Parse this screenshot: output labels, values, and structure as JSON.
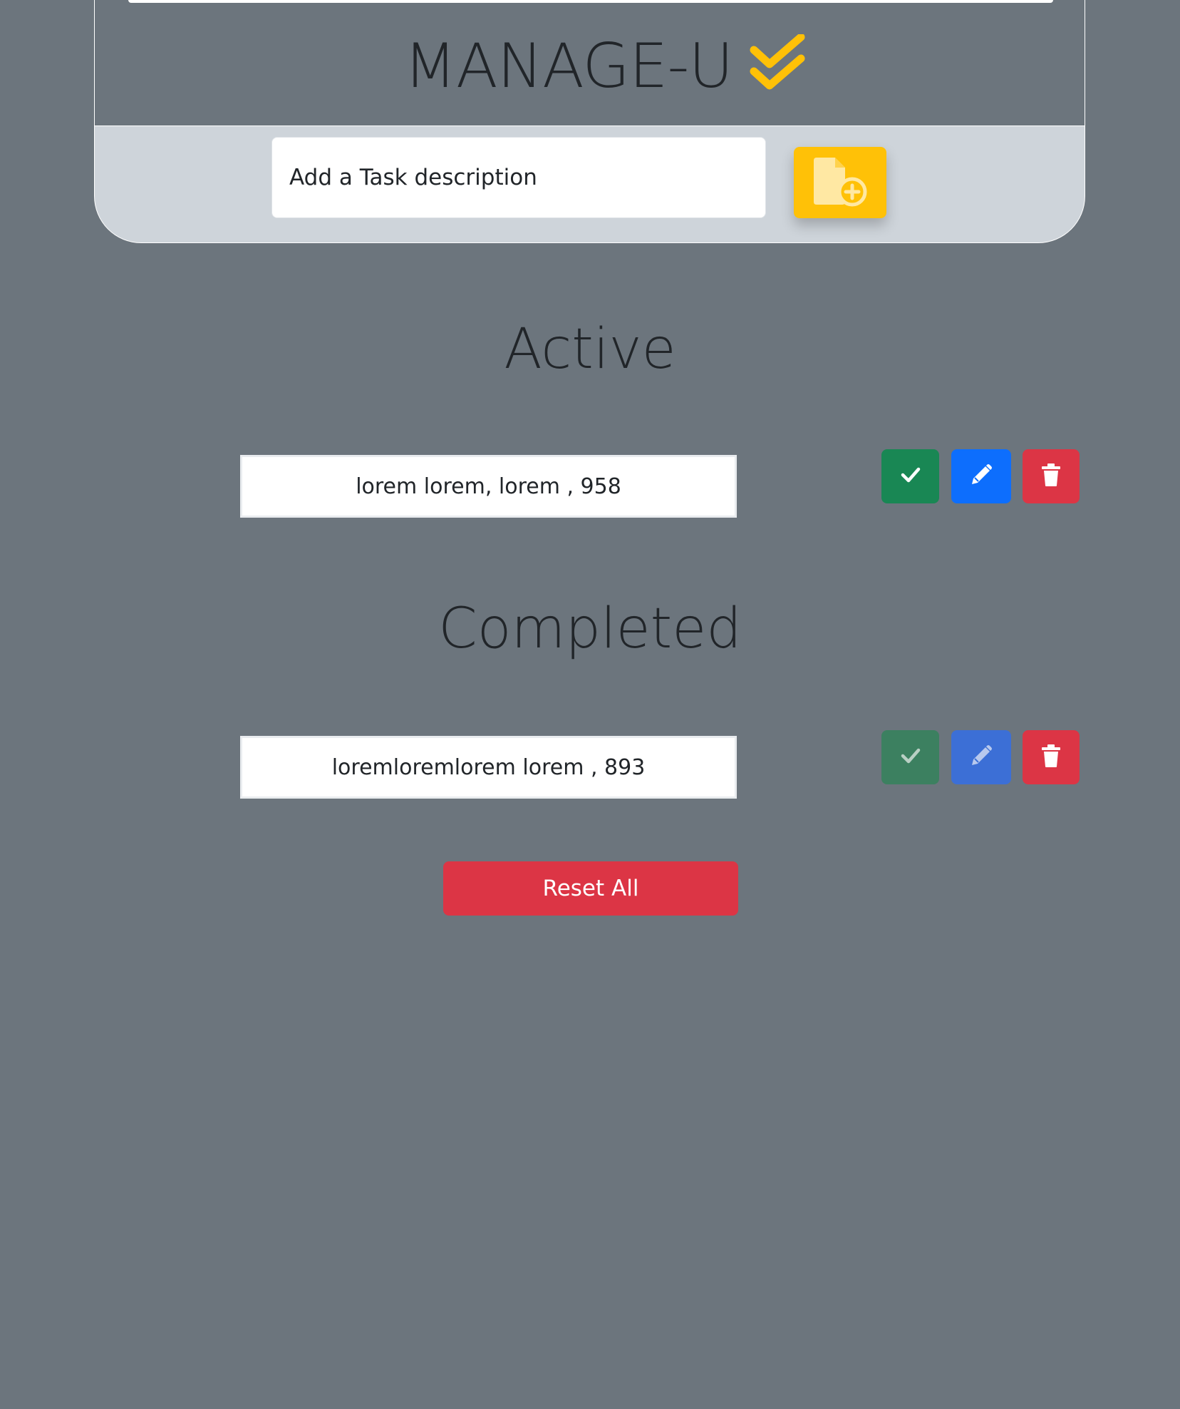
{
  "header": {
    "title": "MANAGE-U",
    "logo_icon": "double-check-icon",
    "input_placeholder": "Add a Task description",
    "add_button_icon": "file-add-icon"
  },
  "sections": {
    "active_heading": "Active",
    "completed_heading": "Completed"
  },
  "tasks": {
    "active": [
      {
        "text": "lorem lorem, lorem , 958"
      }
    ],
    "completed": [
      {
        "text": "loremloremlorem lorem , 893"
      }
    ]
  },
  "task_actions": {
    "complete_icon": "check-icon",
    "edit_icon": "pencil-icon",
    "delete_icon": "trash-icon"
  },
  "footer": {
    "reset_label": "Reset All"
  },
  "colors": {
    "background": "#6c757d",
    "header_panel": "#ced4da",
    "accent": "#ffc107",
    "success": "#198754",
    "primary": "#0d6efd",
    "danger": "#dc3545"
  }
}
